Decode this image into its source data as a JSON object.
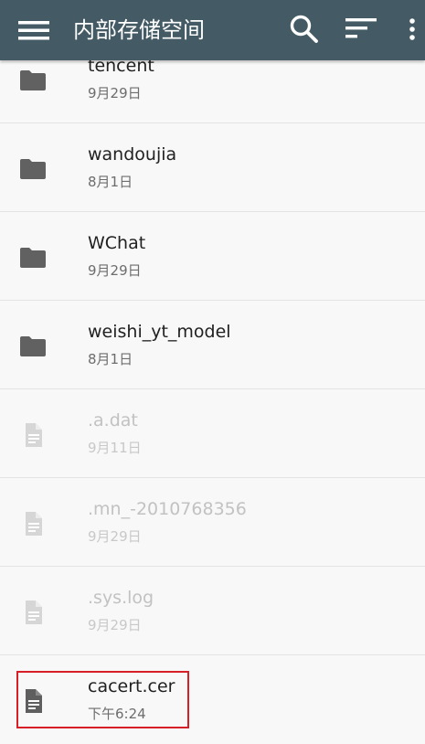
{
  "appbar": {
    "title": "内部存储空间",
    "menu_icon": "menu-icon",
    "search_icon": "search-icon",
    "sort_icon": "sort-icon",
    "more_icon": "more-vert-icon",
    "background_color": "#445a64"
  },
  "files": [
    {
      "name": "tencent",
      "date": "9月29日",
      "type": "folder",
      "hidden": false
    },
    {
      "name": "wandoujia",
      "date": "8月1日",
      "type": "folder",
      "hidden": false
    },
    {
      "name": "WChat",
      "date": "9月29日",
      "type": "folder",
      "hidden": false
    },
    {
      "name": "weishi_yt_model",
      "date": "8月1日",
      "type": "folder",
      "hidden": false
    },
    {
      "name": ".a.dat",
      "date": "9月11日",
      "type": "file",
      "hidden": true
    },
    {
      "name": ".mn_-2010768356",
      "date": "9月29日",
      "type": "file",
      "hidden": true
    },
    {
      "name": ".sys.log",
      "date": "9月29日",
      "type": "file",
      "hidden": true
    },
    {
      "name": "cacert.cer",
      "date": "下午6:24",
      "type": "file",
      "hidden": false
    }
  ],
  "colors": {
    "folder_icon": "#616161",
    "file_icon": "#5f5f5f",
    "hidden_icon": "#d6d6d6",
    "highlight_border": "#d61f26"
  }
}
